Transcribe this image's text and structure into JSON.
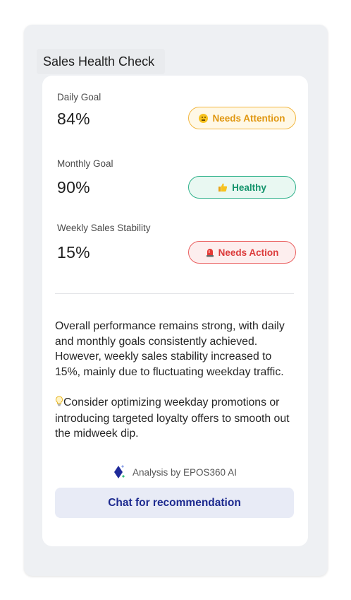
{
  "card": {
    "title": "Sales Health Check",
    "metrics": [
      {
        "label": "Daily Goal",
        "value": "84%",
        "status": "Needs Attention",
        "status_icon": "neutral-face-emoji-icon",
        "color": "#e0960f"
      },
      {
        "label": "Monthly Goal",
        "value": "90%",
        "status": "Healthy",
        "status_icon": "thumbs-up-emoji-icon",
        "color": "#14946c"
      },
      {
        "label": "Weekly Sales Stability",
        "value": "15%",
        "status": "Needs Action",
        "status_icon": "alarm-light-emoji-icon",
        "color": "#dc3b3b"
      }
    ],
    "summary": "Overall performance remains strong, with daily and monthly goals consistently achieved. However, weekly sales stability increased to 15%, mainly due to fluctuating weekday traffic.",
    "tip": "Consider optimizing weekday promotions or introducing targeted loyalty offers to smooth out the midweek dip.",
    "tip_icon": "lightbulb-icon",
    "analysis_credit": "Analysis by EPOS360 AI",
    "analysis_icon": "epos360-diamond-logo-icon",
    "chat_button": "Chat for recommendation",
    "accent_color": "#1d2a8f"
  }
}
